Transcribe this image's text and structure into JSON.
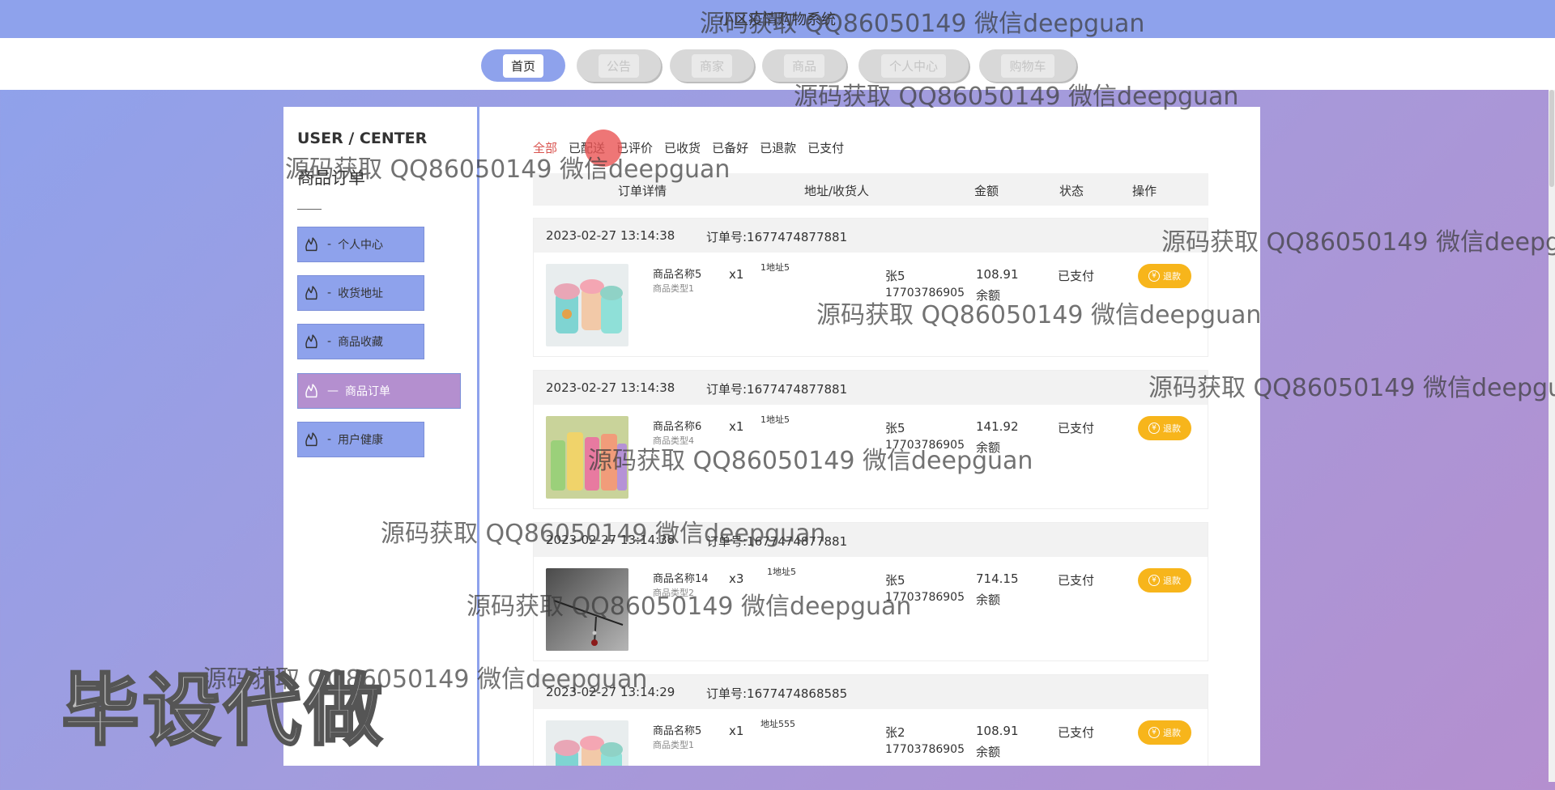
{
  "site": {
    "title": "小区疫情购物系统"
  },
  "nav": [
    {
      "label": "首页"
    },
    {
      "label": "公告"
    },
    {
      "label": "商家"
    },
    {
      "label": "商品"
    },
    {
      "label": "个人中心"
    },
    {
      "label": "购物车"
    }
  ],
  "sidebar": {
    "title": "USER / CENTER",
    "subtitle": "商品订单",
    "items": [
      {
        "label": "个人中心"
      },
      {
        "label": "收货地址"
      },
      {
        "label": "商品收藏"
      },
      {
        "label": "商品订单"
      },
      {
        "label": "用户健康"
      }
    ]
  },
  "filters": [
    "全部",
    "已配送",
    "已评价",
    "已收货",
    "已备好",
    "已退款",
    "已支付"
  ],
  "table_headers": [
    "订单详情",
    "地址/收货人",
    "金额",
    "状态",
    "操作"
  ],
  "orders": [
    {
      "date": "2023-02-27 13:14:38",
      "order_no": "订单号:1677474877881",
      "product": "商品名称5",
      "type": "商品类型1",
      "qty": "x1",
      "address": "1地址5",
      "receiver": "张5",
      "phone": "17703786905",
      "amount": "108.91",
      "pay": "余额",
      "status": "已支付",
      "action": "退款"
    },
    {
      "date": "2023-02-27 13:14:38",
      "order_no": "订单号:1677474877881",
      "product": "商品名称6",
      "type": "商品类型4",
      "qty": "x1",
      "address": "1地址5",
      "receiver": "张5",
      "phone": "17703786905",
      "amount": "141.92",
      "pay": "余额",
      "status": "已支付",
      "action": "退款"
    },
    {
      "date": "2023-02-27 13:14:38",
      "order_no": "订单号:1677474877881",
      "product": "商品名称14",
      "type": "商品类型2",
      "qty": "x3",
      "address": "1地址5",
      "receiver": "张5",
      "phone": "17703786905",
      "amount": "714.15",
      "pay": "余额",
      "status": "已支付",
      "action": "退款"
    },
    {
      "date": "2023-02-27 13:14:29",
      "order_no": "订单号:1677474868585",
      "product": "商品名称5",
      "type": "商品类型1",
      "qty": "x1",
      "address": "地址555",
      "receiver": "张2",
      "phone": "17703786905",
      "amount": "108.91",
      "pay": "余额",
      "status": "已支付",
      "action": "退款"
    }
  ],
  "watermark": {
    "text": "源码获取 QQ86050149 微信deepguan",
    "big": "毕设代做"
  },
  "colors": {
    "accent": "#8ea2ec",
    "active_menu": "#b48fcf",
    "refund": "#f7b51b",
    "filter_active": "#d9534f"
  }
}
